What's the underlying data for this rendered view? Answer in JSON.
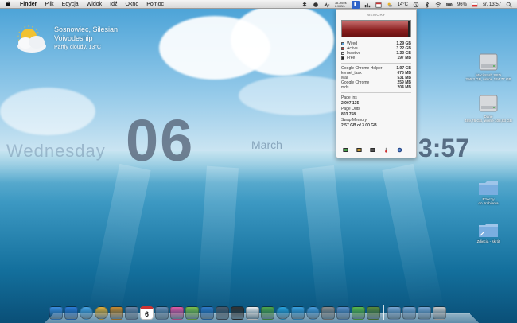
{
  "menubar": {
    "menus": [
      "Finder",
      "Plik",
      "Edycja",
      "Widok",
      "Idź",
      "Okno",
      "Pomoc"
    ],
    "battery": "96%",
    "temperature": "14°C",
    "clock": "śr. 13:57",
    "memory_tab_icon": "memory-tab-icon",
    "net_rates": [
      "38.7KB/s",
      "6.9KB/s"
    ]
  },
  "weather": {
    "city": "Sosnowiec, Silesian",
    "region": "Voivodeship",
    "description": "Partly cloudy, 13°C"
  },
  "clock_widget": {
    "day": "Wednesday",
    "date": "06",
    "month": "March",
    "time": "3:57"
  },
  "memory_panel": {
    "title": "MEMORY",
    "legend": [
      {
        "label": "Wired",
        "value": "1.29 GB",
        "color": "#5aa0d8"
      },
      {
        "label": "Active",
        "value": "3.22 GB",
        "color": "#c23a3a"
      },
      {
        "label": "Inactive",
        "value": "3.30 GB",
        "color": "#e8e8e8"
      },
      {
        "label": "Free",
        "value": "197 MB",
        "color": "#222222"
      }
    ],
    "processes": [
      {
        "label": "Google Chrome Helper",
        "value": "1.97 GB"
      },
      {
        "label": "kernel_task",
        "value": "675 MB"
      },
      {
        "label": "Mail",
        "value": "531 MB"
      },
      {
        "label": "Google Chrome",
        "value": "259 MB"
      },
      {
        "label": "mds",
        "value": "204 MB"
      }
    ],
    "page_ins_label": "Page Ins",
    "page_ins_value": "2 907 135",
    "page_outs_label": "Page Outs",
    "page_outs_value": "803 758",
    "swap_label": "Swap Memory",
    "swap_value": "2.57 GB of 3.00 GB"
  },
  "desktop": {
    "items": [
      {
        "label": "Macintosh SSD",
        "sub": "256,3 GB, wolne 134,77 GB"
      },
      {
        "label": "Dane",
        "sub": "499,76 GB, wolne 108,83 GB"
      },
      {
        "label": "Rzeczy",
        "sub": "do zrobienia"
      },
      {
        "label": "Zdjęcia - skrót",
        "sub": ""
      }
    ]
  },
  "dock": {
    "date_badge": "6",
    "apps": [
      {
        "name": "finder-icon",
        "color": "#3b8de0"
      },
      {
        "name": "appstore-icon",
        "color": "#2c7bd6"
      },
      {
        "name": "safari-icon",
        "color": "#4aa7e8"
      },
      {
        "name": "chrome-icon",
        "color": "#e3b23c"
      },
      {
        "name": "box-icon",
        "color": "#c98a2e"
      },
      {
        "name": "mail-icon",
        "color": "#6c86a6"
      },
      {
        "name": "calendar-icon",
        "color": "#ffffff"
      },
      {
        "name": "photos-icon",
        "color": "#6b8fb4"
      },
      {
        "name": "itunes-pink-icon",
        "color": "#e35aa5"
      },
      {
        "name": "spotify-icon",
        "color": "#7cc14b"
      },
      {
        "name": "music-icon",
        "color": "#2f7ac8"
      },
      {
        "name": "preview-icon",
        "color": "#4b5a6a"
      },
      {
        "name": "sonos-icon",
        "color": "#333333"
      },
      {
        "name": "pages-icon",
        "color": "#f0f0f0"
      },
      {
        "name": "evernote-icon",
        "color": "#4fa64a"
      },
      {
        "name": "skype-icon",
        "color": "#2aa4e0"
      },
      {
        "name": "twitter-icon",
        "color": "#39a0e0"
      },
      {
        "name": "messages-icon",
        "color": "#4a9fe0"
      },
      {
        "name": "system-prefs-icon",
        "color": "#8a8a8a"
      },
      {
        "name": "utilities-icon",
        "color": "#5a8fc8"
      },
      {
        "name": "coda-icon",
        "color": "#5ab84a"
      },
      {
        "name": "sparrow-icon",
        "color": "#5a8a3a"
      }
    ],
    "right_items": [
      {
        "name": "downloads-folder-icon",
        "color": "#7aa7d4"
      },
      {
        "name": "apps-folder-icon",
        "color": "#7aa7d4"
      },
      {
        "name": "documents-folder-icon",
        "color": "#7aa7d4"
      },
      {
        "name": "trash-icon",
        "color": "#c9c9c9"
      }
    ]
  }
}
